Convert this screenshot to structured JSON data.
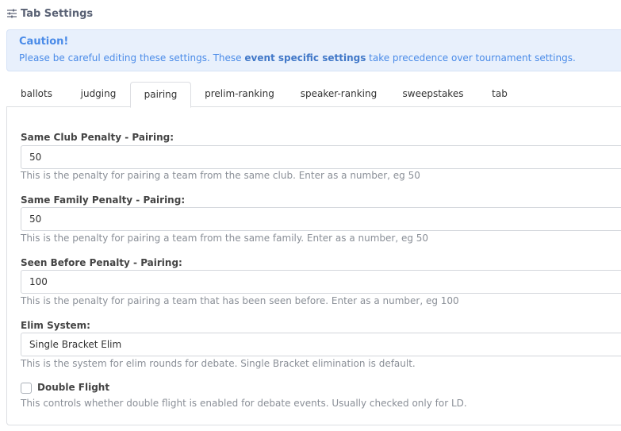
{
  "header": {
    "title": "Tab Settings",
    "icon": "sliders-icon"
  },
  "alert": {
    "title": "Caution!",
    "message_pre": "Please be careful editing these settings. These ",
    "message_bold": "event specific settings",
    "message_post": " take precedence over tournament settings.",
    "color": "#4a8be8",
    "background": "#e8f0fc"
  },
  "tabs": [
    {
      "label": "ballots"
    },
    {
      "label": "judging"
    },
    {
      "label": "pairing",
      "active": true
    },
    {
      "label": "prelim-ranking"
    },
    {
      "label": "speaker-ranking"
    },
    {
      "label": "sweepstakes"
    },
    {
      "label": "tab"
    }
  ],
  "fields": {
    "same_club": {
      "label": "Same Club Penalty - Pairing:",
      "value": "50",
      "help": "This is the penalty for pairing a team from the same club. Enter as a number, eg 50"
    },
    "same_family": {
      "label": "Same Family Penalty - Pairing:",
      "value": "50",
      "help": "This is the penalty for pairing a team from the same family. Enter as a number, eg 50"
    },
    "seen_before": {
      "label": "Seen Before Penalty - Pairing:",
      "value": "100",
      "help": "This is the penalty for pairing a team that has been seen before. Enter as a number, eg 100"
    },
    "elim_system": {
      "label": "Elim System:",
      "value": "Single Bracket Elim",
      "help": "This is the system for elim rounds for debate. Single Bracket elimination is default."
    },
    "double_flight": {
      "label": "Double Flight",
      "checked": false,
      "help": "This controls whether double flight is enabled for debate events. Usually checked only for LD."
    }
  }
}
